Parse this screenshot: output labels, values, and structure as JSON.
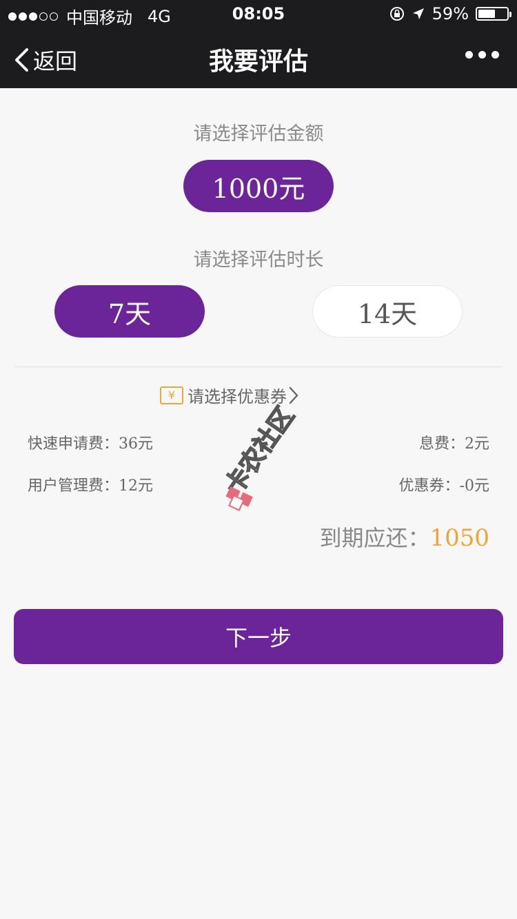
{
  "status_bar": {
    "carrier": "中国移动",
    "network": "4G",
    "time": "08:05",
    "battery_percent": "59%",
    "battery_level": 0.59
  },
  "nav": {
    "back_label": "返回",
    "title": "我要评估"
  },
  "amount": {
    "label": "请选择评估金额",
    "options": [
      "1000元"
    ],
    "selected": "1000元"
  },
  "duration": {
    "label": "请选择评估时长",
    "options": [
      "7天",
      "14天"
    ],
    "selected": "7天"
  },
  "coupon": {
    "prompt": "请选择优惠券",
    "icon": "yen-ticket-icon",
    "icon_glyph": "¥",
    "icon_color": "#e4a93e"
  },
  "fees": {
    "quick_apply_label": "快速申请费：",
    "quick_apply_value": "36元",
    "interest_label": "息费：",
    "interest_value": "2元",
    "management_label": "用户管理费：",
    "management_value": "12元",
    "coupon_label": "优惠券：",
    "coupon_value": "-0元"
  },
  "due": {
    "label": "到期应还：",
    "value": "1050"
  },
  "next_button": "下一步",
  "watermark_text": "卡农社区",
  "colors": {
    "accent": "#6c2499",
    "amount_highlight": "#f0a432",
    "nav_bg": "#1c1c1e"
  }
}
